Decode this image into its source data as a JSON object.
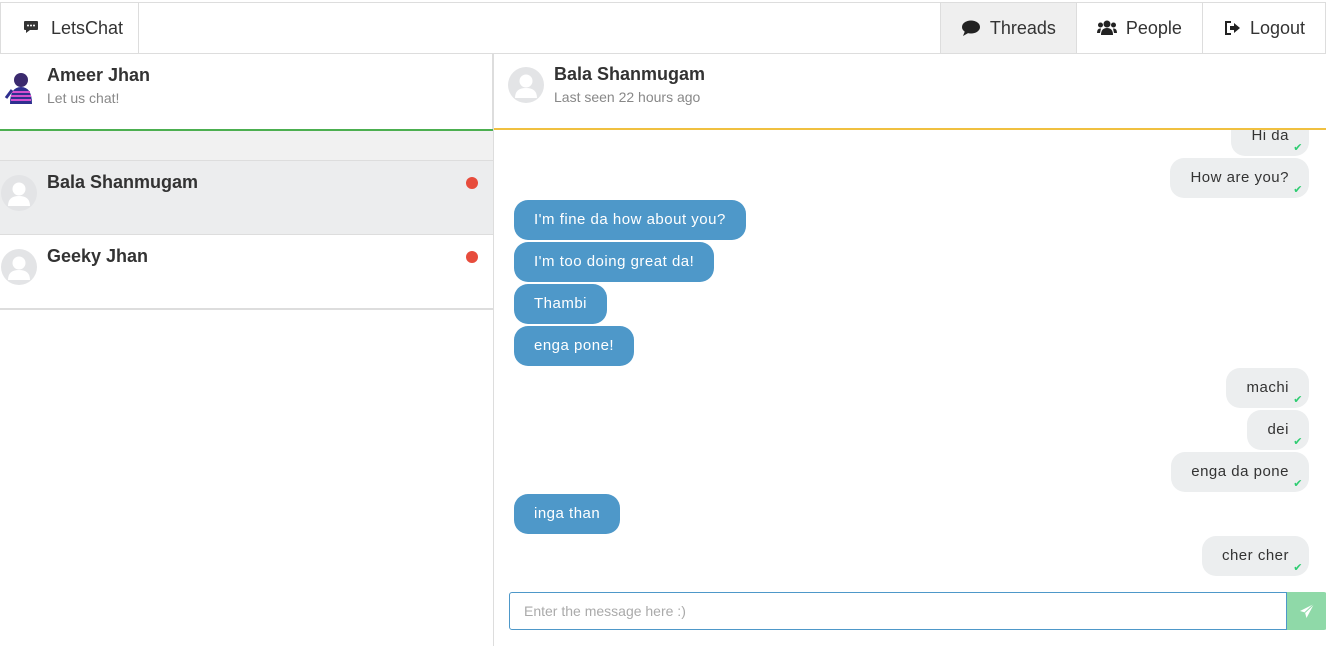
{
  "navbar": {
    "brand": "LetsChat",
    "items": [
      {
        "label": "Threads",
        "icon": "comment-icon",
        "active": true
      },
      {
        "label": "People",
        "icon": "users-icon",
        "active": false
      },
      {
        "label": "Logout",
        "icon": "sign-out-icon",
        "active": false
      }
    ]
  },
  "me": {
    "name": "Ameer Jhan",
    "status": "Let us chat!"
  },
  "threads": [
    {
      "name": "Bala Shanmugam",
      "unread": true
    },
    {
      "name": "Geeky Jhan",
      "unread": true
    }
  ],
  "chat": {
    "name": "Bala Shanmugam",
    "last_seen": "Last seen 22 hours ago",
    "messages": [
      {
        "text": "Hi da",
        "dir": "out"
      },
      {
        "text": "How are you?",
        "dir": "out"
      },
      {
        "text": "I'm fine da how about you?",
        "dir": "in"
      },
      {
        "text": "I'm too doing great da!",
        "dir": "in"
      },
      {
        "text": "Thambi",
        "dir": "in"
      },
      {
        "text": "enga pone!",
        "dir": "in"
      },
      {
        "text": "machi",
        "dir": "out"
      },
      {
        "text": "dei",
        "dir": "out"
      },
      {
        "text": "enga da pone",
        "dir": "out"
      },
      {
        "text": "inga than",
        "dir": "in"
      },
      {
        "text": "cher cher",
        "dir": "out"
      }
    ],
    "input_placeholder": "Enter the message here :)",
    "input_value": ""
  },
  "colors": {
    "incoming_bubble": "#4e98c9",
    "outgoing_bubble": "#eceeef",
    "unread_dot": "#e74c3c",
    "me_underline": "#4caf50",
    "chat_header_underline": "#f0c040",
    "send_button": "#8fd9a8",
    "read_tick": "#2ecc71"
  }
}
